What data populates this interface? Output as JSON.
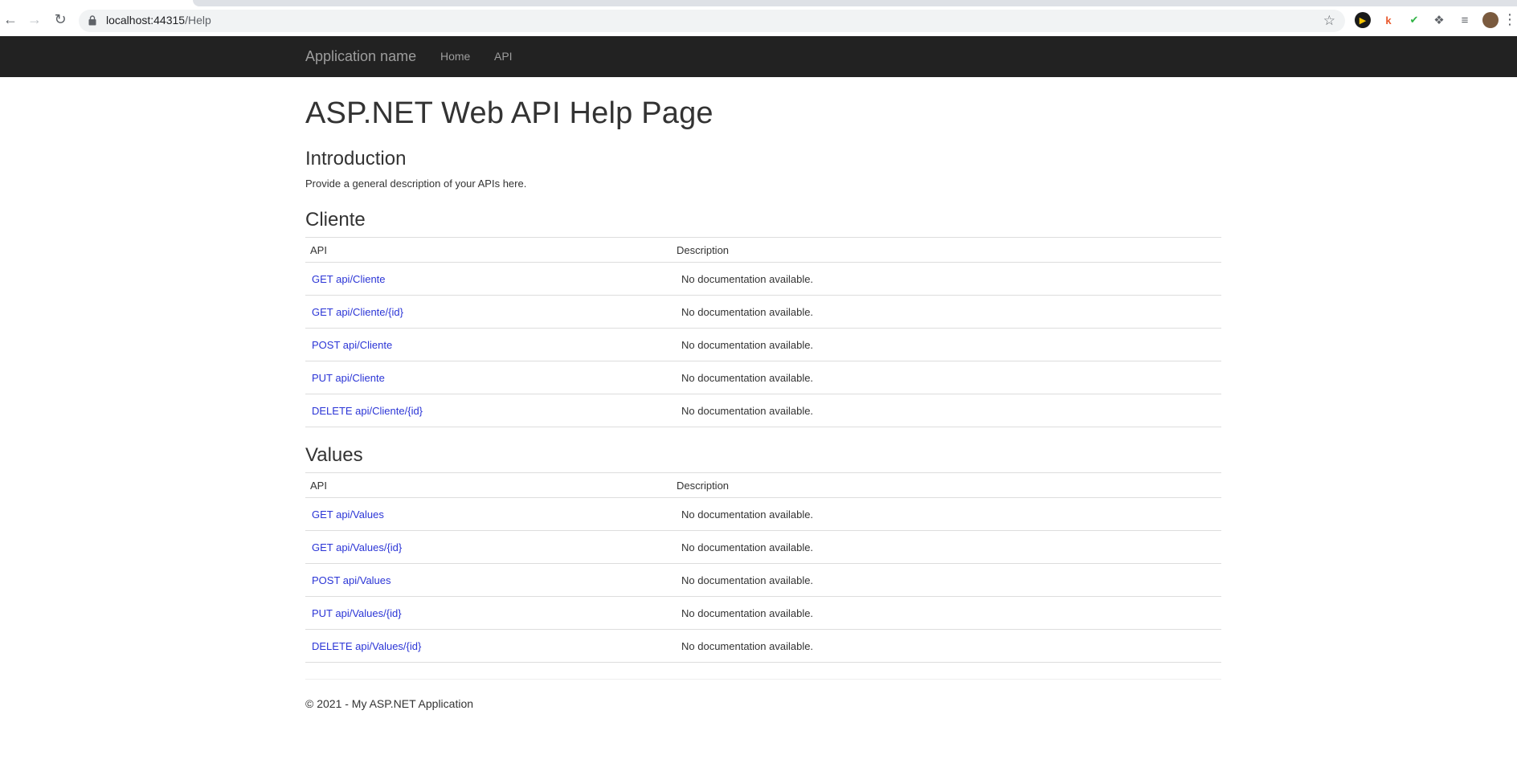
{
  "browser": {
    "url_host": "localhost:44315",
    "url_path": "/Help"
  },
  "navbar": {
    "brand": "Application name",
    "links": [
      {
        "label": "Home"
      },
      {
        "label": "API"
      }
    ]
  },
  "page": {
    "title": "ASP.NET Web API Help Page",
    "intro_heading": "Introduction",
    "intro_text": "Provide a general description of your APIs here."
  },
  "sections": [
    {
      "heading": "Cliente",
      "col_api": "API",
      "col_desc": "Description",
      "rows": [
        {
          "api": "GET api/Cliente",
          "desc": "No documentation available."
        },
        {
          "api": "GET api/Cliente/{id}",
          "desc": "No documentation available."
        },
        {
          "api": "POST api/Cliente",
          "desc": "No documentation available."
        },
        {
          "api": "PUT api/Cliente",
          "desc": "No documentation available."
        },
        {
          "api": "DELETE api/Cliente/{id}",
          "desc": "No documentation available."
        }
      ]
    },
    {
      "heading": "Values",
      "col_api": "API",
      "col_desc": "Description",
      "rows": [
        {
          "api": "GET api/Values",
          "desc": "No documentation available."
        },
        {
          "api": "GET api/Values/{id}",
          "desc": "No documentation available."
        },
        {
          "api": "POST api/Values",
          "desc": "No documentation available."
        },
        {
          "api": "PUT api/Values/{id}",
          "desc": "No documentation available."
        },
        {
          "api": "DELETE api/Values/{id}",
          "desc": "No documentation available."
        }
      ]
    }
  ],
  "footer": {
    "text": "© 2021 - My ASP.NET Application"
  },
  "colors": {
    "navbar_bg": "#222222",
    "navbar_text": "#9d9d9d",
    "link": "#2b35d6"
  }
}
